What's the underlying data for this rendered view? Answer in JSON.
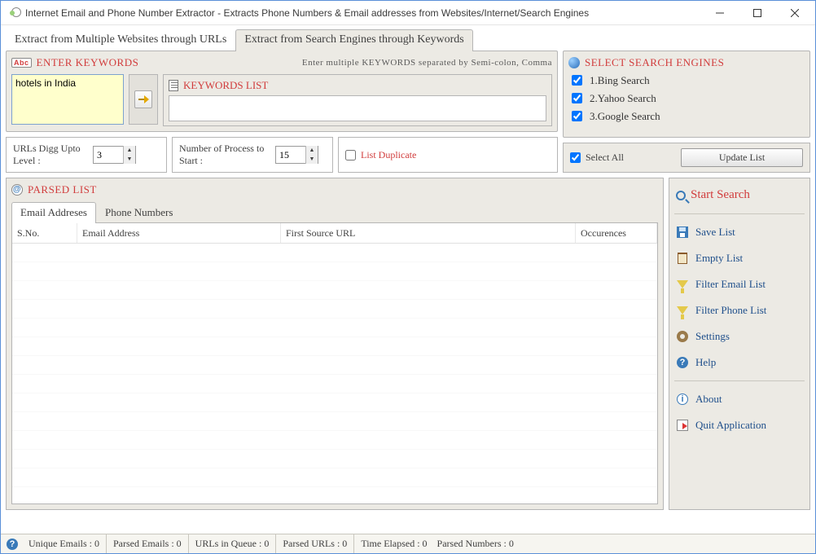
{
  "window": {
    "title": "Internet Email and Phone Number Extractor - Extracts Phone Numbers & Email addresses from Websites/Internet/Search Engines"
  },
  "main_tabs": {
    "urls": "Extract from Multiple Websites through URLs",
    "keywords": "Extract from Search Engines through Keywords"
  },
  "keywords": {
    "title": "ENTER KEYWORDS",
    "hint": "Enter multiple KEYWORDS separated by Semi-colon, Comma",
    "input_value": "hotels in India",
    "list_title": "KEYWORDS LIST"
  },
  "options": {
    "digg_label": "URLs Digg Upto Level :",
    "digg_value": "3",
    "proc_label": "Number of Process to Start :",
    "proc_value": "15",
    "list_dup_label": "List Duplicate"
  },
  "search_engines": {
    "title": "SELECT SEARCH ENGINES",
    "items": [
      "1.Bing Search",
      "2.Yahoo Search",
      "3.Google Search"
    ],
    "select_all": "Select All",
    "update_btn": "Update List"
  },
  "parsed": {
    "title": "PARSED LIST",
    "tab_email": "Email Addreses",
    "tab_phone": "Phone Numbers",
    "cols": {
      "sno": "S.No.",
      "email": "Email Address",
      "url": "First Source URL",
      "occ": "Occurences"
    }
  },
  "sidebar": {
    "start": "Start Search",
    "save": "Save List",
    "empty": "Empty List",
    "filter_email": "Filter Email List",
    "filter_phone": "Filter Phone List",
    "settings": "Settings",
    "help": "Help",
    "about": "About",
    "quit": "Quit Application"
  },
  "status": {
    "unique": "Unique Emails :  0",
    "parsed_e": "Parsed Emails :  0",
    "queue": "URLs in Queue :  0",
    "parsed_u": "Parsed URLs :  0",
    "elapsed": "Time Elapsed :  0",
    "parsed_n": "Parsed Numbers :   0"
  }
}
